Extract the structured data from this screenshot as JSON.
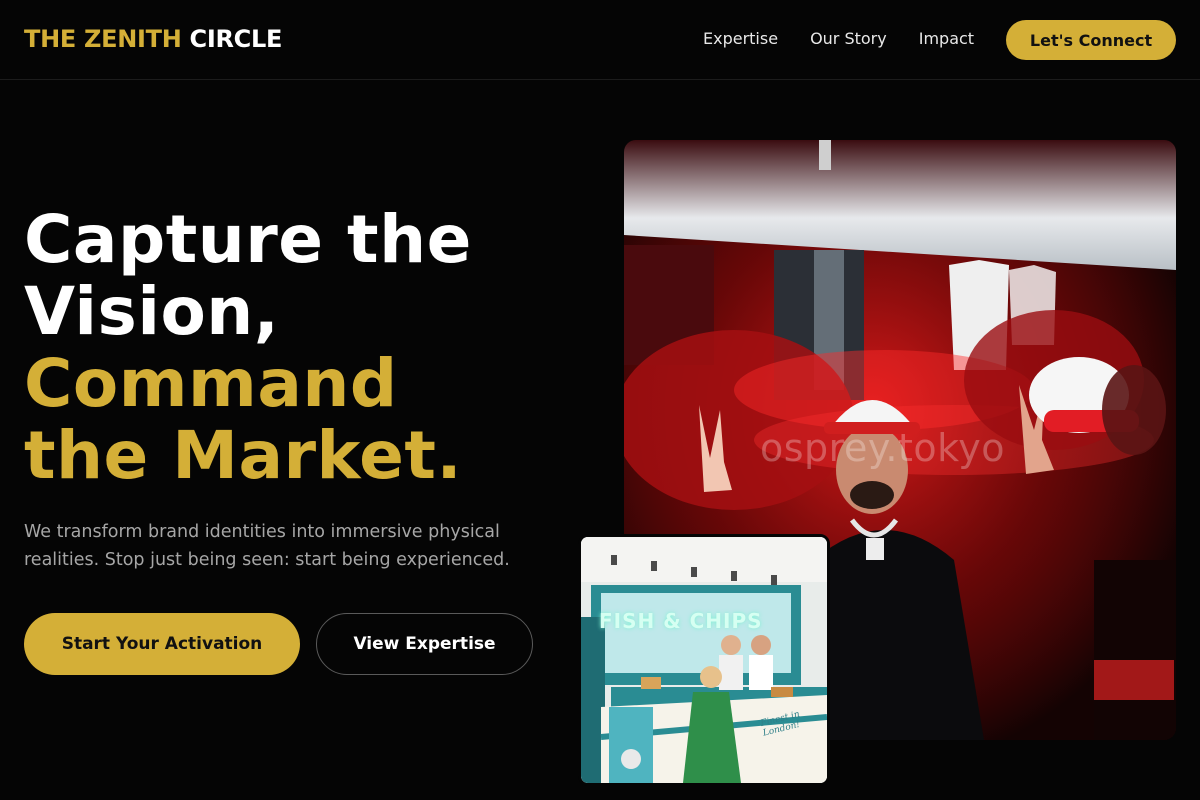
{
  "brand": {
    "name_part1": "THE ZENITH",
    "name_part2": "CIRCLE"
  },
  "nav": {
    "links": [
      "Expertise",
      "Our Story",
      "Impact"
    ],
    "cta_label": "Let's Connect"
  },
  "hero": {
    "headline_white": [
      "Capture the",
      "Vision,"
    ],
    "headline_gold": [
      "Command",
      "the Market."
    ],
    "subtext": "We transform brand identities into immersive physical realities. Stop just being seen: start being experienced.",
    "primary_button": "Start Your Activation",
    "secondary_button": "View Expertise"
  },
  "images": {
    "main_watermark": "osprey.tokyo",
    "shop_sign": "FISH & CHIPS",
    "truck_text": "Finest in London!"
  },
  "colors": {
    "accent": "#d4af37",
    "background": "#050505",
    "muted_text": "#a6a6a6"
  }
}
